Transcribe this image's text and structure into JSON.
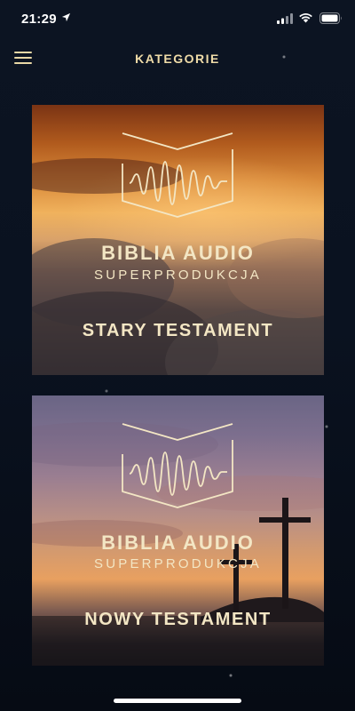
{
  "status_bar": {
    "time": "21:29",
    "icons": [
      "location-arrow-icon",
      "cellular-signal-icon",
      "wifi-icon",
      "battery-icon"
    ]
  },
  "nav": {
    "title": "KATEGORIE",
    "menu_icon": "hamburger-menu-icon"
  },
  "categories": [
    {
      "brand_title": "BIBLIA AUDIO",
      "brand_subtitle": "SUPERPRODUKCJA",
      "label": "STARY TESTAMENT"
    },
    {
      "brand_title": "BIBLIA AUDIO",
      "brand_subtitle": "SUPERPRODUKCJA",
      "label": "NOWY TESTAMENT"
    }
  ],
  "colors": {
    "accent_text": "#f0dca8",
    "background": "#0b1321"
  }
}
